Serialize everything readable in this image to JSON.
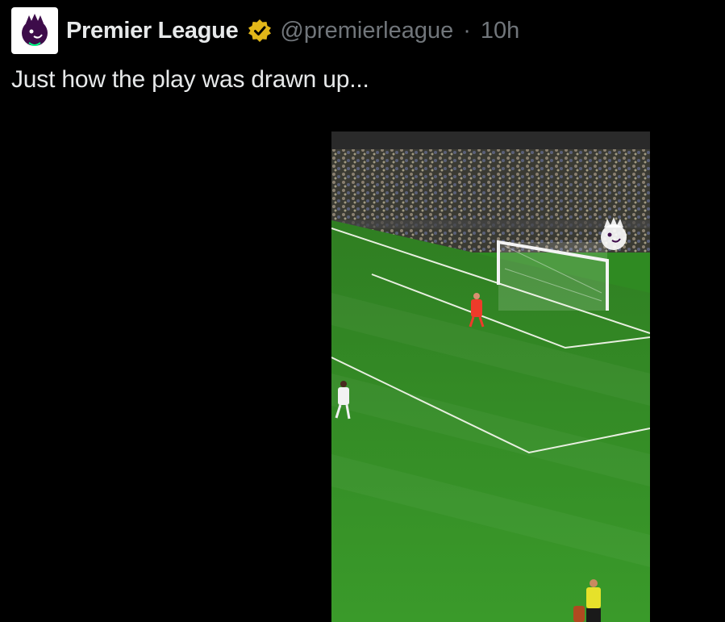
{
  "tweet": {
    "display_name": "Premier League",
    "handle": "@premierleague",
    "separator": "·",
    "time": "10h",
    "text": "Just how the play was drawn up..."
  },
  "icons": {
    "avatar": "premier-league-lion-logo",
    "verified": "gold-verified-badge",
    "watermark": "premier-league-lion-watermark"
  },
  "colors": {
    "background": "#000000",
    "name": "#e7e9ea",
    "secondary": "#71767b",
    "verified": "#e2b719",
    "pitch": "#2f8a22"
  }
}
